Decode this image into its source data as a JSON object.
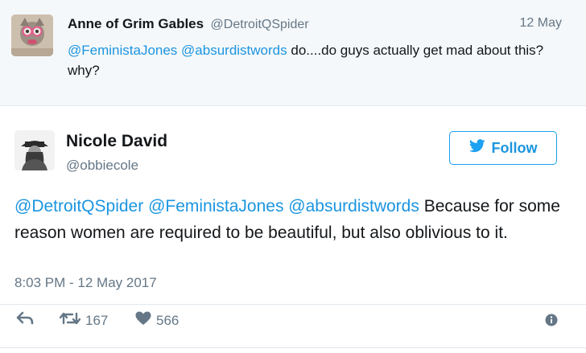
{
  "parent_tweet": {
    "name": "Anne of Grim Gables",
    "handle": "@DetroitQSpider",
    "date": "12 May",
    "mentions": [
      "@FeministaJones",
      "@absurdistwords"
    ],
    "text": "do....do guys actually get mad about this? why?"
  },
  "main_tweet": {
    "name": "Nicole David",
    "handle": "@obbiecole",
    "follow_label": "Follow",
    "mentions": [
      "@DetroitQSpider",
      "@FeministaJones",
      "@absurdistwords"
    ],
    "text": "Because for some reason women are required to be beautiful, but also oblivious to it.",
    "timestamp": "8:03 PM - 12 May 2017",
    "retweet_count": "167",
    "like_count": "566"
  },
  "icons": {
    "reply": "reply-icon",
    "retweet": "retweet-icon",
    "like": "heart-icon",
    "info": "info-icon",
    "bird": "twitter-bird-icon"
  },
  "colors": {
    "accent": "#1da1f2",
    "mention": "#1b95e0",
    "muted": "#657786",
    "parent_bg": "#f5f8fa"
  }
}
